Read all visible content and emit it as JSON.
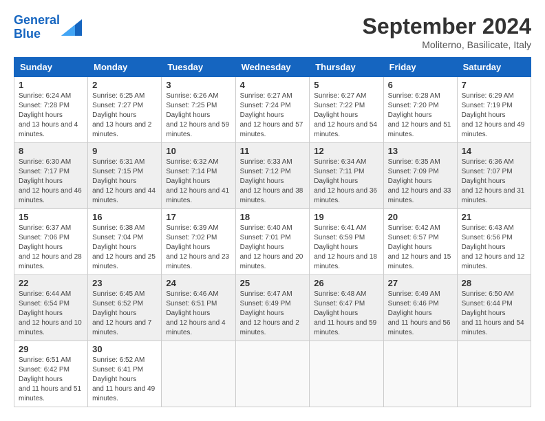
{
  "header": {
    "logo_line1": "General",
    "logo_line2": "Blue",
    "month_title": "September 2024",
    "location": "Moliterno, Basilicate, Italy"
  },
  "weekdays": [
    "Sunday",
    "Monday",
    "Tuesday",
    "Wednesday",
    "Thursday",
    "Friday",
    "Saturday"
  ],
  "weeks": [
    [
      {
        "day": "1",
        "sunrise": "6:24 AM",
        "sunset": "7:28 PM",
        "daylight": "13 hours and 4 minutes."
      },
      {
        "day": "2",
        "sunrise": "6:25 AM",
        "sunset": "7:27 PM",
        "daylight": "13 hours and 2 minutes."
      },
      {
        "day": "3",
        "sunrise": "6:26 AM",
        "sunset": "7:25 PM",
        "daylight": "12 hours and 59 minutes."
      },
      {
        "day": "4",
        "sunrise": "6:27 AM",
        "sunset": "7:24 PM",
        "daylight": "12 hours and 57 minutes."
      },
      {
        "day": "5",
        "sunrise": "6:27 AM",
        "sunset": "7:22 PM",
        "daylight": "12 hours and 54 minutes."
      },
      {
        "day": "6",
        "sunrise": "6:28 AM",
        "sunset": "7:20 PM",
        "daylight": "12 hours and 51 minutes."
      },
      {
        "day": "7",
        "sunrise": "6:29 AM",
        "sunset": "7:19 PM",
        "daylight": "12 hours and 49 minutes."
      }
    ],
    [
      {
        "day": "8",
        "sunrise": "6:30 AM",
        "sunset": "7:17 PM",
        "daylight": "12 hours and 46 minutes."
      },
      {
        "day": "9",
        "sunrise": "6:31 AM",
        "sunset": "7:15 PM",
        "daylight": "12 hours and 44 minutes."
      },
      {
        "day": "10",
        "sunrise": "6:32 AM",
        "sunset": "7:14 PM",
        "daylight": "12 hours and 41 minutes."
      },
      {
        "day": "11",
        "sunrise": "6:33 AM",
        "sunset": "7:12 PM",
        "daylight": "12 hours and 38 minutes."
      },
      {
        "day": "12",
        "sunrise": "6:34 AM",
        "sunset": "7:11 PM",
        "daylight": "12 hours and 36 minutes."
      },
      {
        "day": "13",
        "sunrise": "6:35 AM",
        "sunset": "7:09 PM",
        "daylight": "12 hours and 33 minutes."
      },
      {
        "day": "14",
        "sunrise": "6:36 AM",
        "sunset": "7:07 PM",
        "daylight": "12 hours and 31 minutes."
      }
    ],
    [
      {
        "day": "15",
        "sunrise": "6:37 AM",
        "sunset": "7:06 PM",
        "daylight": "12 hours and 28 minutes."
      },
      {
        "day": "16",
        "sunrise": "6:38 AM",
        "sunset": "7:04 PM",
        "daylight": "12 hours and 25 minutes."
      },
      {
        "day": "17",
        "sunrise": "6:39 AM",
        "sunset": "7:02 PM",
        "daylight": "12 hours and 23 minutes."
      },
      {
        "day": "18",
        "sunrise": "6:40 AM",
        "sunset": "7:01 PM",
        "daylight": "12 hours and 20 minutes."
      },
      {
        "day": "19",
        "sunrise": "6:41 AM",
        "sunset": "6:59 PM",
        "daylight": "12 hours and 18 minutes."
      },
      {
        "day": "20",
        "sunrise": "6:42 AM",
        "sunset": "6:57 PM",
        "daylight": "12 hours and 15 minutes."
      },
      {
        "day": "21",
        "sunrise": "6:43 AM",
        "sunset": "6:56 PM",
        "daylight": "12 hours and 12 minutes."
      }
    ],
    [
      {
        "day": "22",
        "sunrise": "6:44 AM",
        "sunset": "6:54 PM",
        "daylight": "12 hours and 10 minutes."
      },
      {
        "day": "23",
        "sunrise": "6:45 AM",
        "sunset": "6:52 PM",
        "daylight": "12 hours and 7 minutes."
      },
      {
        "day": "24",
        "sunrise": "6:46 AM",
        "sunset": "6:51 PM",
        "daylight": "12 hours and 4 minutes."
      },
      {
        "day": "25",
        "sunrise": "6:47 AM",
        "sunset": "6:49 PM",
        "daylight": "12 hours and 2 minutes."
      },
      {
        "day": "26",
        "sunrise": "6:48 AM",
        "sunset": "6:47 PM",
        "daylight": "11 hours and 59 minutes."
      },
      {
        "day": "27",
        "sunrise": "6:49 AM",
        "sunset": "6:46 PM",
        "daylight": "11 hours and 56 minutes."
      },
      {
        "day": "28",
        "sunrise": "6:50 AM",
        "sunset": "6:44 PM",
        "daylight": "11 hours and 54 minutes."
      }
    ],
    [
      {
        "day": "29",
        "sunrise": "6:51 AM",
        "sunset": "6:42 PM",
        "daylight": "11 hours and 51 minutes."
      },
      {
        "day": "30",
        "sunrise": "6:52 AM",
        "sunset": "6:41 PM",
        "daylight": "11 hours and 49 minutes."
      },
      null,
      null,
      null,
      null,
      null
    ]
  ]
}
